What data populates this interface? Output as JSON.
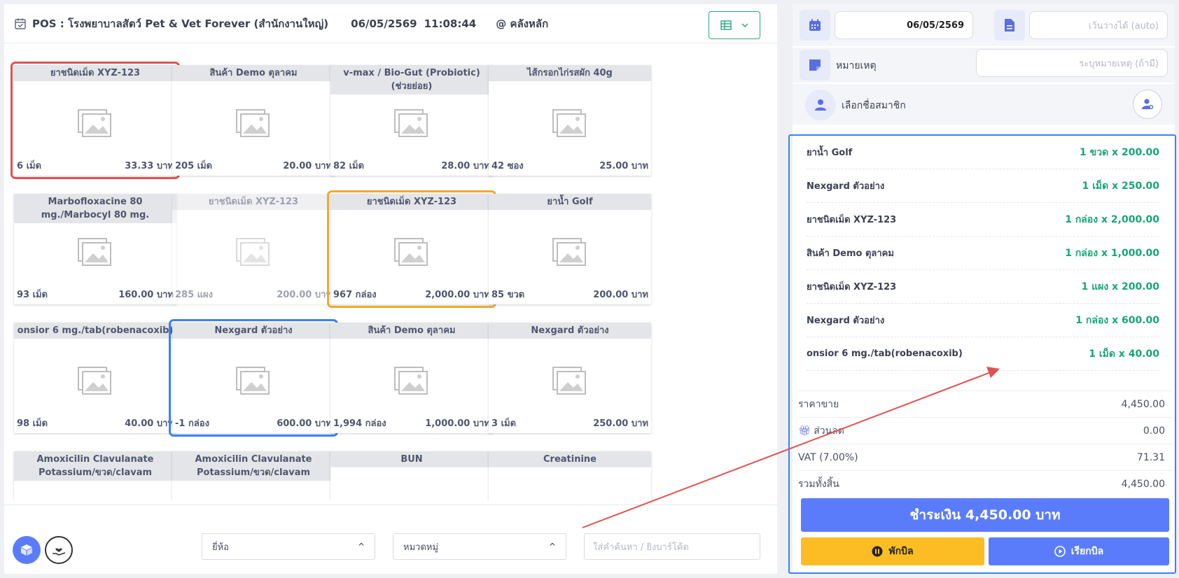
{
  "header": {
    "title": "POS : โรงพยาบาลสัตว์ Pet & Vet Forever (สำนักงานใหญ่)",
    "date": "06/05/2569",
    "time": "11:08:44",
    "store": "@ คลังหลัก",
    "view_icon": "table-icon"
  },
  "products": [
    {
      "name": "ยาชนิดเม็ด XYZ-123",
      "qty": "6 เม็ด",
      "price": "33.33 บาท"
    },
    {
      "name": "สินค้า Demo ตุลาคม",
      "qty": "205 เม็ด",
      "price": "20.00 บาท"
    },
    {
      "name": "v-max / Bio-Gut (Probiotic) (ช่วยย่อย)",
      "qty": "82 เม็ด",
      "price": "28.00 บาท"
    },
    {
      "name": "ไส้กรอกไก่รสผัก 40g",
      "qty": "42 ซอง",
      "price": "25.00 บาท"
    },
    {
      "name": "Marbofloxacine 80 mg./Marbocyl 80 mg.",
      "qty": "93 เม็ด",
      "price": "160.00 บาท"
    },
    {
      "name": "ยาชนิดเม็ด XYZ-123",
      "qty": "285 แผง",
      "price": "200.00 บาท"
    },
    {
      "name": "ยาชนิดเม็ด XYZ-123",
      "qty": "967 กล่อง",
      "price": "2,000.00 บาท"
    },
    {
      "name": "ยาน้ำ Golf",
      "qty": "85 ขวด",
      "price": "200.00 บาท"
    },
    {
      "name": "onsior 6 mg./tab(robenacoxib)",
      "qty": "98 เม็ด",
      "price": "40.00 บาท"
    },
    {
      "name": "Nexgard ตัวอย่าง",
      "qty": "-1 กล่อง",
      "price": "600.00 บาท"
    },
    {
      "name": "สินค้า Demo ตุลาคม",
      "qty": "1,994 กล่อง",
      "price": "1,000.00 บาท"
    },
    {
      "name": "Nexgard ตัวอย่าง",
      "qty": "3 เม็ด",
      "price": "250.00 บาท"
    },
    {
      "name": "Amoxicilin Clavulanate Potassium/ขวด/clavam",
      "qty": "",
      "price": ""
    },
    {
      "name": "Amoxicilin Clavulanate Potassium/ขวด/clavam",
      "qty": "",
      "price": ""
    },
    {
      "name": "BUN",
      "qty": "",
      "price": ""
    },
    {
      "name": "Creatinine",
      "qty": "",
      "price": ""
    }
  ],
  "footer": {
    "brand_label": "ยี่ห้อ",
    "category_label": "หมวดหมู่",
    "search_placeholder": "ใส่คำค้นหา / ยิงบาร์โค้ด"
  },
  "right": {
    "date": "06/05/2569",
    "doc_placeholder": "เว้นว่างได้ (auto)",
    "note_label": "หมายเหตุ",
    "note_placeholder": "ระบุหมายเหตุ (ถ้ามี)",
    "member_label": "เลือกชื่อสมาชิก"
  },
  "cart": [
    {
      "name": "ยาน้ำ Golf",
      "value": "1 ขวด x 200.00"
    },
    {
      "name": "Nexgard ตัวอย่าง",
      "value": "1 เม็ด x 250.00"
    },
    {
      "name": "ยาชนิดเม็ด XYZ-123",
      "value": "1 กล่อง x 2,000.00"
    },
    {
      "name": "สินค้า Demo ตุลาคม",
      "value": "1 กล่อง x 1,000.00"
    },
    {
      "name": "ยาชนิดเม็ด XYZ-123",
      "value": "1 แผง x 200.00"
    },
    {
      "name": "Nexgard ตัวอย่าง",
      "value": "1 กล่อง x 600.00"
    },
    {
      "name": "onsior 6 mg./tab(robenacoxib)",
      "value": "1 เม็ด x 40.00"
    }
  ],
  "summary": {
    "subtotal_label": "ราคาขาย",
    "subtotal": "4,450.00",
    "discount_label": "ส่วนลด",
    "discount": "0.00",
    "vat_label": "VAT (7.00%)",
    "vat": "71.31",
    "total_label": "รวมทั้งสิ้น",
    "total": "4,450.00"
  },
  "actions": {
    "pay_label": "ชำระเงิน 4,450.00 บาท",
    "hold_label": "พักบิล",
    "recall_label": "เรียกบิล"
  },
  "colors": {
    "accent": "#5b7cfa",
    "green": "#17a673",
    "highlight_red": "#e05252",
    "highlight_orange": "#f0a830",
    "highlight_blue": "#3b82f6",
    "hold": "#fbbd23"
  }
}
